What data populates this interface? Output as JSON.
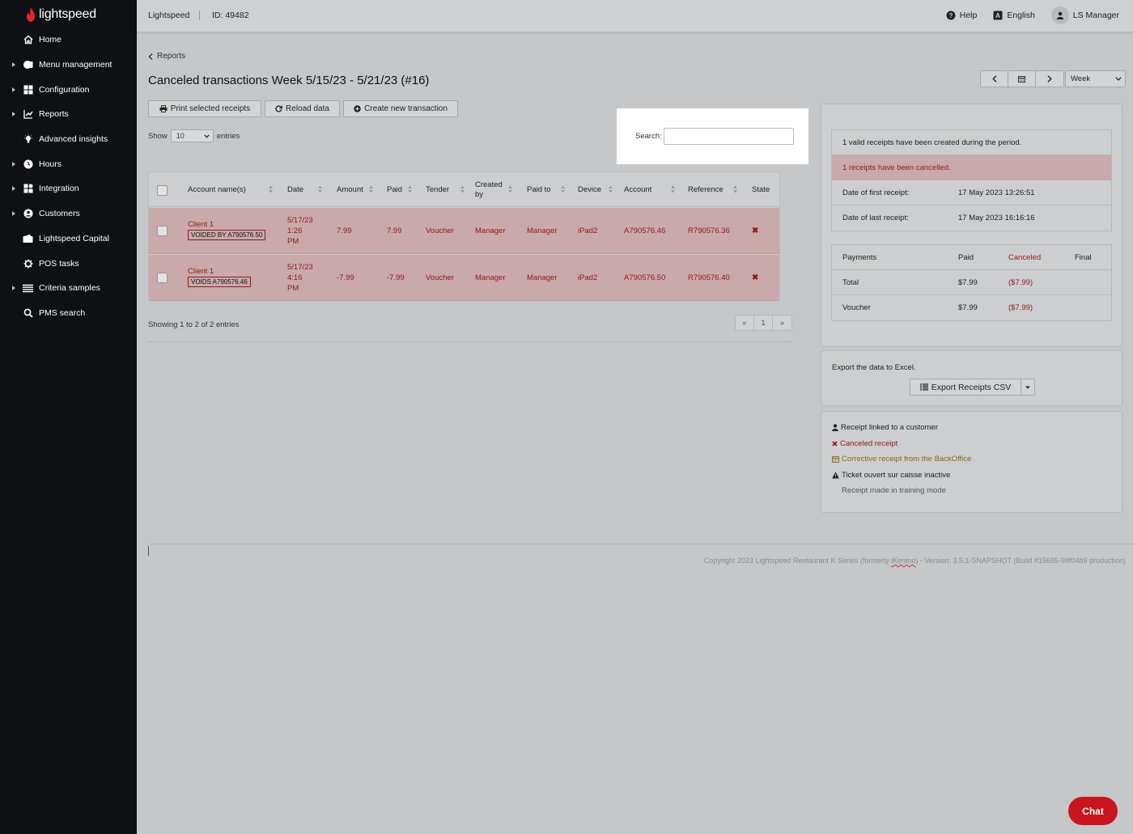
{
  "app": {
    "logo_text": "lightspeed"
  },
  "sidebar": {
    "items": [
      {
        "label": "Home",
        "icon": "home-icon",
        "caret": false
      },
      {
        "label": "Menu management",
        "icon": "menu-management-icon",
        "caret": true
      },
      {
        "label": "Configuration",
        "icon": "configuration-icon",
        "caret": true
      },
      {
        "label": "Reports",
        "icon": "reports-icon",
        "caret": true
      },
      {
        "label": "Advanced insights",
        "icon": "lightbulb-icon",
        "caret": false
      },
      {
        "label": "Hours",
        "icon": "clock-icon",
        "caret": true
      },
      {
        "label": "Integration",
        "icon": "integration-icon",
        "caret": true
      },
      {
        "label": "Customers",
        "icon": "customers-icon",
        "caret": true
      },
      {
        "label": "Lightspeed Capital",
        "icon": "wallet-icon",
        "caret": false
      },
      {
        "label": "POS tasks",
        "icon": "gear-icon",
        "caret": false
      },
      {
        "label": "Criteria samples",
        "icon": "list-icon",
        "caret": true
      },
      {
        "label": "PMS search",
        "icon": "search-icon",
        "caret": false
      }
    ]
  },
  "topbar": {
    "brand": "Lightspeed",
    "id_label": "ID:",
    "id_value": "49482",
    "help": "Help",
    "language": "English",
    "user": "LS Manager"
  },
  "breadcrumb": {
    "label": "Reports"
  },
  "page": {
    "title": "Canceled transactions Week 5/15/23 - 5/21/23 (#16)"
  },
  "toolbar": {
    "print": "Print selected receipts",
    "reload": "Reload data",
    "create": "Create new transaction"
  },
  "entries": {
    "show": "Show",
    "value": "10",
    "suffix": "entries"
  },
  "search": {
    "label": "Search:",
    "value": "",
    "placeholder": ""
  },
  "table": {
    "headers": [
      "Account name(s)",
      "Date",
      "Amount",
      "Paid",
      "Tender",
      "Created by",
      "Paid to",
      "Device",
      "Account",
      "Reference",
      "State"
    ],
    "rows": [
      {
        "account": "Client 1",
        "tag": "VOIDED BY A790576.50",
        "date1": "5/17/23",
        "date2": "1:26",
        "date3": "PM",
        "amount": "7.99",
        "paid": "7.99",
        "tender": "Voucher",
        "created_by": "Manager",
        "paid_to": "Manager",
        "device": "iPad2",
        "account_no": "A790576.46",
        "reference": "R790576.36",
        "state": "✖"
      },
      {
        "account": "Client 1",
        "tag": "VOIDS A790576.46",
        "date1": "5/17/23",
        "date2": "4:16",
        "date3": "PM",
        "amount": "-7.99",
        "paid": "-7.99",
        "tender": "Voucher",
        "created_by": "Manager",
        "paid_to": "Manager",
        "device": "iPad2",
        "account_no": "A790576.50",
        "reference": "R790576.40",
        "state": "✖"
      }
    ]
  },
  "showing": "Showing 1 to 2 of 2 entries",
  "pager": {
    "prev": "«",
    "page": "1",
    "next": "»"
  },
  "week": {
    "select": "Week"
  },
  "summary": {
    "valid": "1 valid receipts have been created during the period.",
    "cancelled": "1 receipts have been cancelled.",
    "first_label": "Date of first receipt:",
    "first_value": "17 May 2023 13:26:51",
    "last_label": "Date of last receipt:",
    "last_value": "17 May 2023 16:16:16"
  },
  "payments": {
    "headers": {
      "name": "Payments",
      "paid": "Paid",
      "canceled": "Canceled",
      "final": "Final"
    },
    "rows": [
      {
        "name": "Total",
        "paid": "$7.99",
        "canceled": "($7.99)",
        "final": ""
      },
      {
        "name": "Voucher",
        "paid": "$7.99",
        "canceled": "($7.99)",
        "final": ""
      }
    ]
  },
  "export": {
    "label": "Export the data to Excel.",
    "button": "Export Receipts CSV"
  },
  "legend": {
    "linked": "Receipt linked to a customer",
    "canceled": "Canceled receipt",
    "corrective": "Corrective receipt from the BackOffice",
    "inactive": "Ticket ouvert sur caisse inactive",
    "training": "Receipt made in training mode"
  },
  "footer": {
    "copyright_a": "Copyright 2023 Lightspeed Restaurant K Series (formerly ",
    "copyright_b": "iKentoo",
    "copyright_c": ") - Version: 3.5.1-SNAPSHOT (Build #15685-99f04b9 production)"
  },
  "chat": {
    "label": "Chat"
  },
  "colors": {
    "accent_red": "#c8151e",
    "cancel_red": "#8e1a1a",
    "corrective": "#8a6a1a"
  }
}
